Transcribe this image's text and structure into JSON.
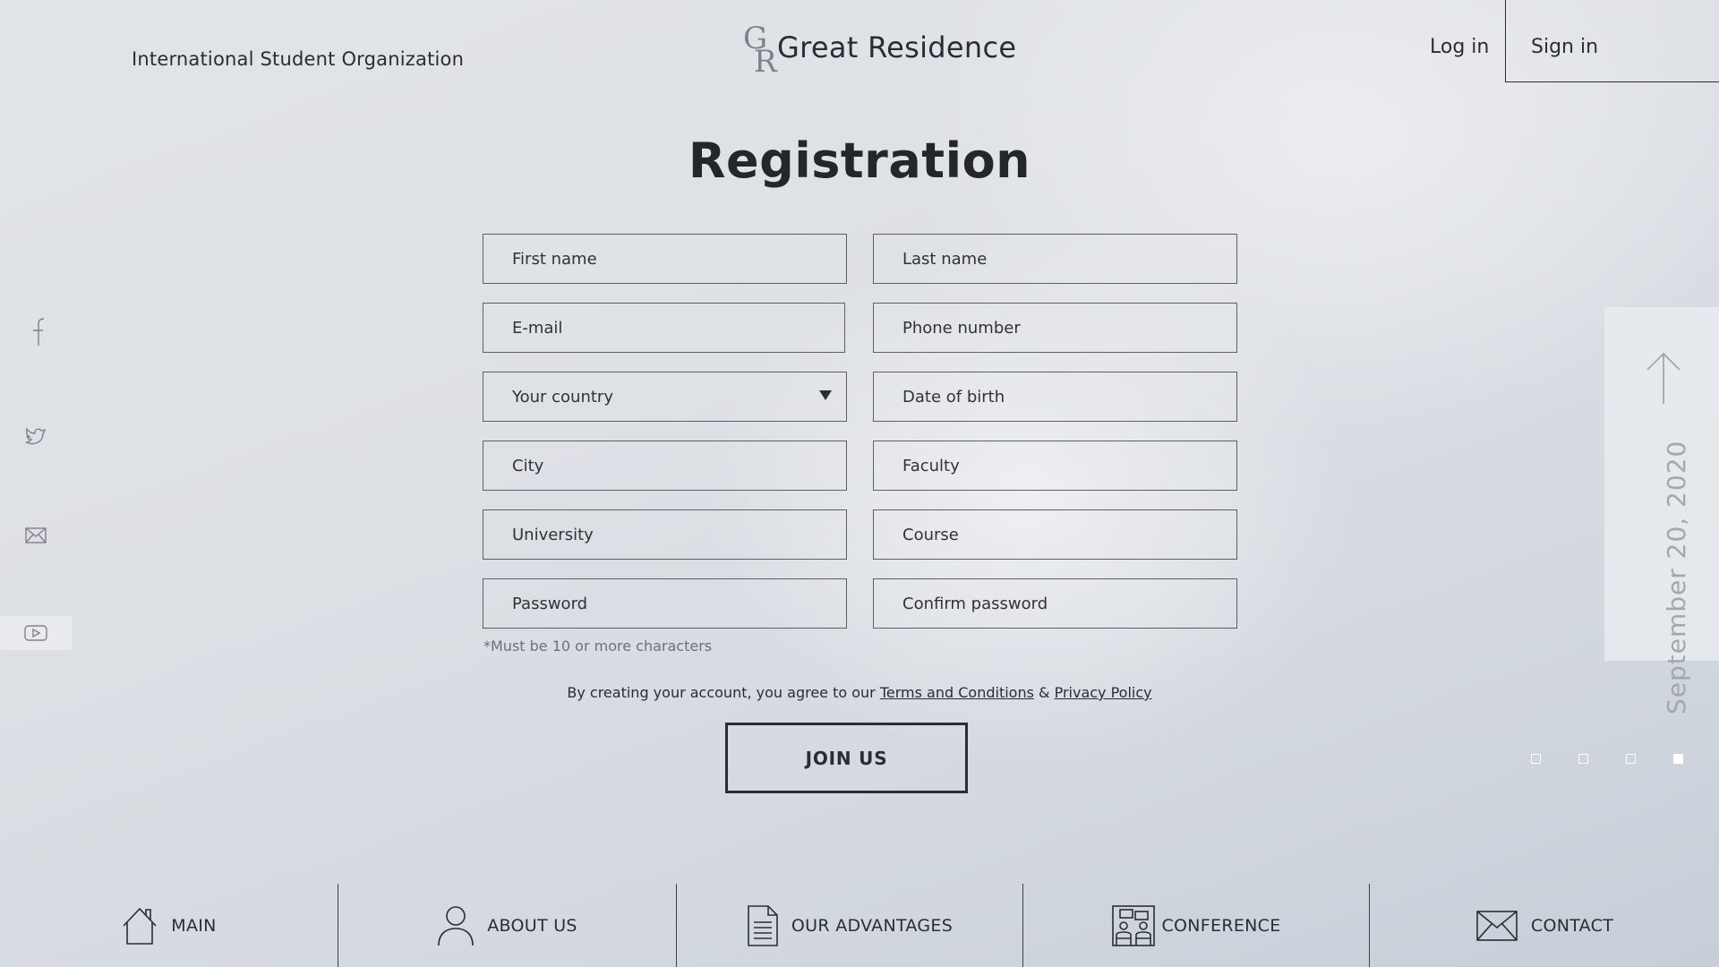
{
  "header": {
    "org_name": "International Student Organization",
    "logo": {
      "mark_g": "G",
      "mark_r": "R",
      "text": "Great Residence"
    },
    "login_label": "Log in",
    "signin_label": "Sign in"
  },
  "page_title": "Registration",
  "form": {
    "first_name": "First name",
    "last_name": "Last name",
    "email": "E-mail",
    "phone": "Phone number",
    "country": "Your country",
    "dob": "Date of birth",
    "city": "City",
    "faculty": "Faculty",
    "university": "University",
    "course": "Course",
    "password": "Password",
    "confirm_password": "Confirm password",
    "password_hint": "*Must be 10 or more characters",
    "terms_prefix": "By creating your account, you agree to our ",
    "terms_link": "Terms and Conditions",
    "terms_amp": " & ",
    "privacy_link": "Privacy Policy",
    "submit_label": "JOIN US"
  },
  "social": [
    "facebook-icon",
    "twitter-icon",
    "mail-icon",
    "youtube-icon"
  ],
  "side_panel": {
    "date": "September 20, 2020",
    "active_slide": 4,
    "slide_count": 4
  },
  "bottom_nav": [
    {
      "label": "MAIN",
      "icon": "home-icon"
    },
    {
      "label": "ABOUT US",
      "icon": "person-icon"
    },
    {
      "label": "OUR ADVANTAGES",
      "icon": "document-icon"
    },
    {
      "label": "CONFERENCE",
      "icon": "conference-icon"
    },
    {
      "label": "CONTACT",
      "icon": "envelope-icon"
    }
  ],
  "colors": {
    "text": "#2a2d33",
    "muted": "#a3a7ae",
    "background": "#dde0e5"
  }
}
